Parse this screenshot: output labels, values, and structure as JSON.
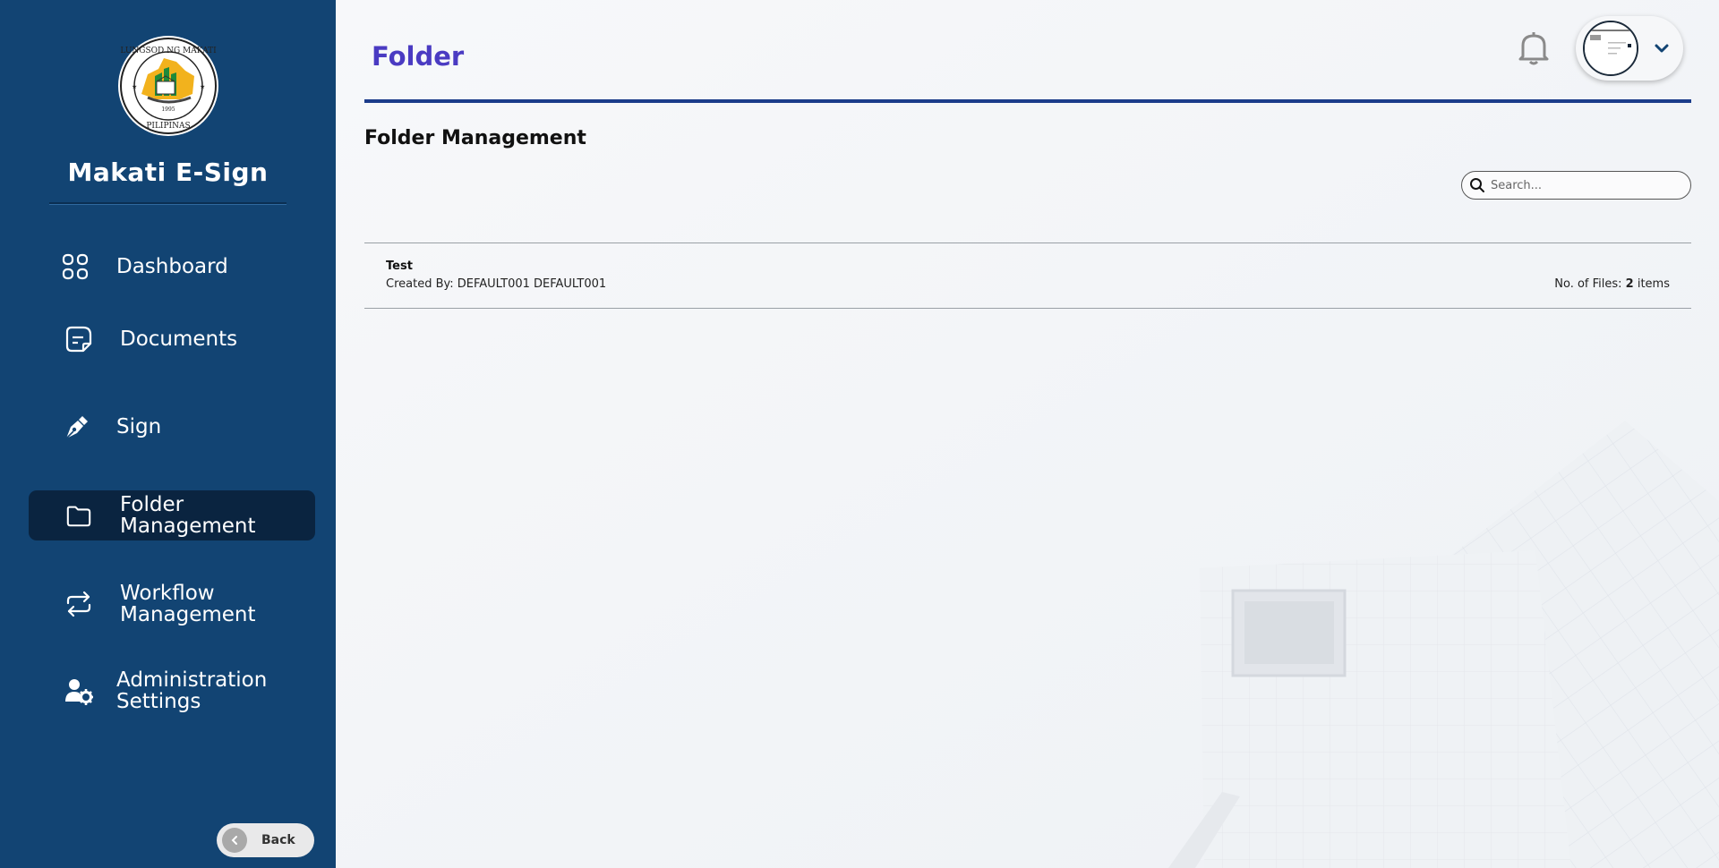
{
  "sidebar": {
    "brand": "Makati E-Sign",
    "logo_text": "LUNGSOD NG MAKATI · PILIPINAS · 1995",
    "items": [
      {
        "label": "Dashboard",
        "icon": "dashboard-grid-icon"
      },
      {
        "label": "Documents",
        "icon": "document-icon"
      },
      {
        "label": "Sign",
        "icon": "pen-nib-icon"
      },
      {
        "label": "Folder Management",
        "icon": "folder-icon",
        "active": true
      },
      {
        "label": "Workflow Management",
        "icon": "repeat-arrows-icon"
      },
      {
        "label": "Administration Settings",
        "icon": "user-gear-icon"
      }
    ],
    "back_label": "Back"
  },
  "header": {
    "title": "Folder",
    "bell_icon": "bell-icon",
    "profile_icon": "chevron-down-icon"
  },
  "main": {
    "section_title": "Folder Management",
    "search": {
      "placeholder": "Search...",
      "value": ""
    },
    "folders": [
      {
        "name": "Test",
        "created_by": "Created By: DEFAULT001 DEFAULT001",
        "files_prefix": "No. of Files: ",
        "files_count": "2",
        "files_suffix": " items"
      }
    ]
  },
  "colors": {
    "sidebar_bg": "#124473",
    "sidebar_active": "#0a2440",
    "title_accent": "#4a3bc2",
    "header_rule": "#1b3c8a"
  }
}
